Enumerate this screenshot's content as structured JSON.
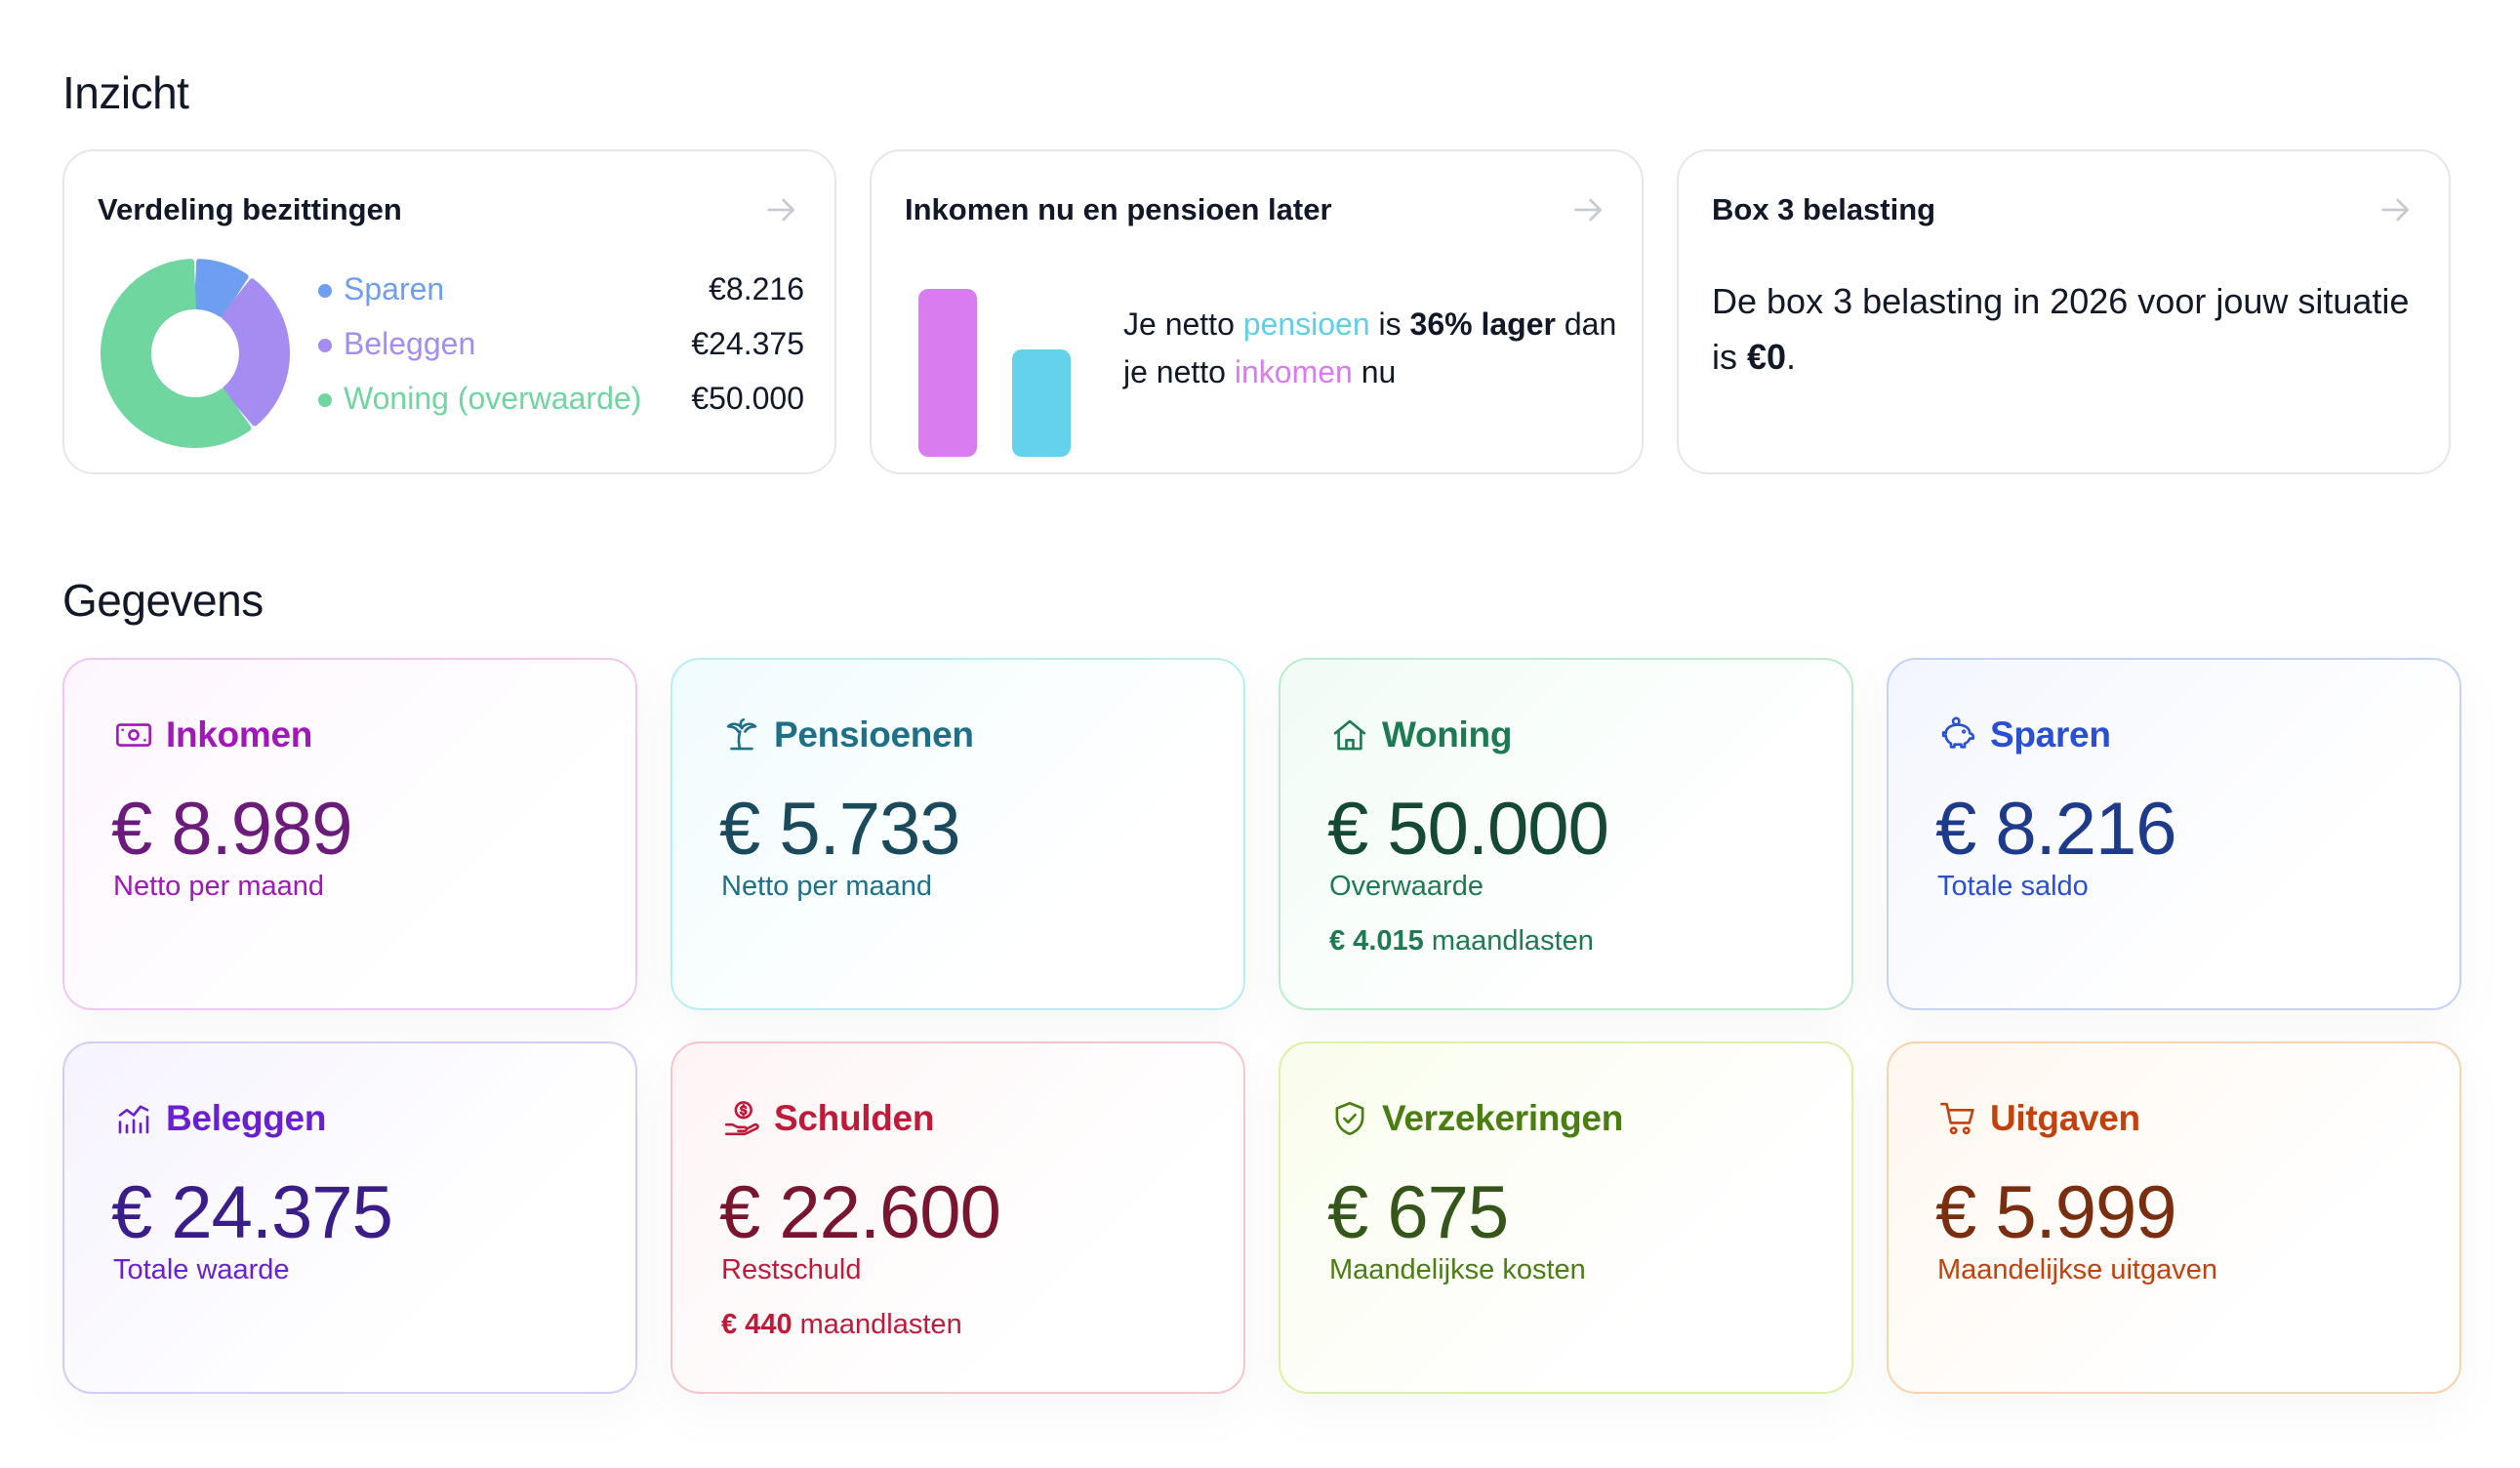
{
  "sections": {
    "insight_title": "Inzicht",
    "data_title": "Gegevens"
  },
  "insight": {
    "distribution": {
      "title": "Verdeling bezittingen",
      "items": [
        {
          "label": "Sparen",
          "value": "€8.216",
          "amount": 8216,
          "color": "#6d9ef0"
        },
        {
          "label": "Beleggen",
          "value": "€24.375",
          "amount": 24375,
          "color": "#a48cf0"
        },
        {
          "label": "Woning (overwaarde)",
          "value": "€50.000",
          "amount": 50000,
          "color": "#6fd6a0"
        }
      ]
    },
    "income_pension": {
      "title": "Inkomen nu en pensioen later",
      "text_part1": "Je netto ",
      "pension_word": "pensioen",
      "text_part2": " is ",
      "percentage": "36% lager",
      "text_part3": " dan je netto ",
      "income_word": "inkomen",
      "text_part4": " nu",
      "pension_ratio": 0.64
    },
    "box3": {
      "title": "Box 3 belasting",
      "text": "De box 3 belasting in 2026 voor jouw situatie is ",
      "amount": "€0",
      "suffix": "."
    }
  },
  "cards": {
    "inkomen": {
      "title": "Inkomen",
      "value": "€ 8.989",
      "subtitle": "Netto per maand",
      "icon": "banknote-icon",
      "title_color": "#a018b8",
      "value_color": "#6b1b7a",
      "sub_color": "#a018b8"
    },
    "pensioenen": {
      "title": "Pensioenen",
      "value": "€ 5.733",
      "subtitle": "Netto per maand",
      "icon": "palm-tree-icon",
      "title_color": "#1f6f86",
      "value_color": "#1a4a5c",
      "sub_color": "#1f6f86"
    },
    "woning": {
      "title": "Woning",
      "value": "€ 50.000",
      "subtitle": "Overwaarde",
      "extra_bold": "€ 4.015",
      "extra_text": " maandlasten",
      "icon": "house-icon",
      "title_color": "#1d7a52",
      "value_color": "#144a35",
      "sub_color": "#1d7a52"
    },
    "sparen": {
      "title": "Sparen",
      "value": "€ 8.216",
      "subtitle": "Totale saldo",
      "icon": "piggy-bank-icon",
      "title_color": "#2a4fd0",
      "value_color": "#1e3a8a",
      "sub_color": "#2a4fd0"
    },
    "beleggen": {
      "title": "Beleggen",
      "value": "€ 24.375",
      "subtitle": "Totale waarde",
      "icon": "chart-bars-icon",
      "title_color": "#6a1fd0",
      "value_color": "#3b1d8a",
      "sub_color": "#6a1fd0"
    },
    "schulden": {
      "title": "Schulden",
      "value": "€ 22.600",
      "subtitle": "Restschuld",
      "extra_bold": "€ 440",
      "extra_text": " maandlasten",
      "icon": "hand-coin-icon",
      "title_color": "#c01a3a",
      "value_color": "#7a1530",
      "sub_color": "#c01a3a"
    },
    "verzekeringen": {
      "title": "Verzekeringen",
      "value": "€ 675",
      "subtitle": "Maandelijkse kosten",
      "icon": "shield-check-icon",
      "title_color": "#4a7d12",
      "value_color": "#35561a",
      "sub_color": "#4a7d12"
    },
    "uitgaven": {
      "title": "Uitgaven",
      "value": "€ 5.999",
      "subtitle": "Maandelijkse uitgaven",
      "icon": "cart-icon",
      "title_color": "#c2410c",
      "value_color": "#7a2e10",
      "sub_color": "#c2410c"
    }
  }
}
